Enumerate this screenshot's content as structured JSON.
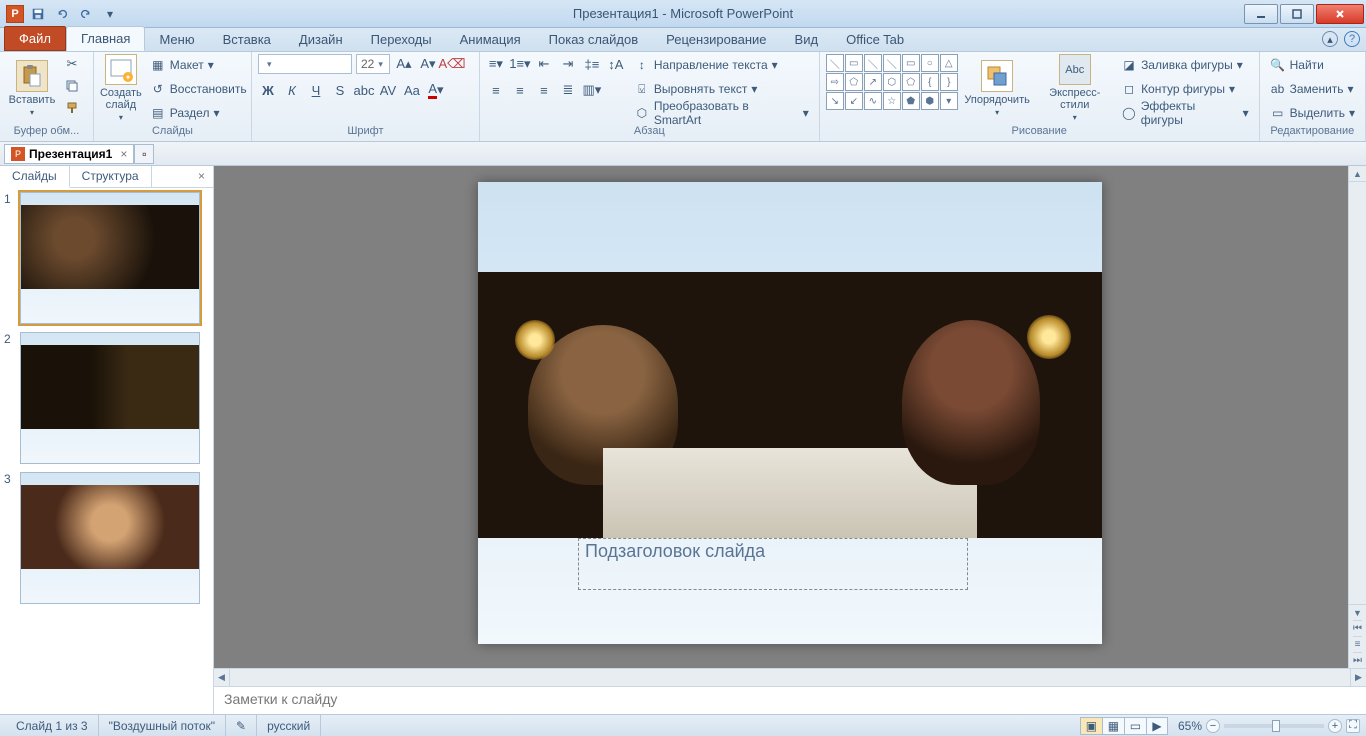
{
  "window": {
    "title": "Презентация1 - Microsoft PowerPoint"
  },
  "tabs": {
    "file": "Файл",
    "items": [
      "Главная",
      "Меню",
      "Вставка",
      "Дизайн",
      "Переходы",
      "Анимация",
      "Показ слайдов",
      "Рецензирование",
      "Вид",
      "Office Tab"
    ],
    "active": "Главная"
  },
  "ribbon": {
    "clipboard": {
      "label": "Буфер обм...",
      "paste": "Вставить"
    },
    "slides": {
      "label": "Слайды",
      "new_slide": "Создать\nслайд",
      "layout": "Макет",
      "reset": "Восстановить",
      "section": "Раздел"
    },
    "font": {
      "label": "Шрифт",
      "size": "22"
    },
    "paragraph": {
      "label": "Абзац",
      "text_direction": "Направление текста",
      "align_text": "Выровнять текст",
      "smartart": "Преобразовать в SmartArt"
    },
    "drawing": {
      "label": "Рисование",
      "arrange": "Упорядочить",
      "quick_styles": "Экспресс-стили",
      "shape_fill": "Заливка фигуры",
      "shape_outline": "Контур фигуры",
      "shape_effects": "Эффекты фигуры"
    },
    "editing": {
      "label": "Редактирование",
      "find": "Найти",
      "replace": "Заменить",
      "select": "Выделить"
    }
  },
  "doctabs": {
    "name": "Презентация1"
  },
  "panel": {
    "slides_tab": "Слайды",
    "outline_tab": "Структура",
    "count": 3
  },
  "slide": {
    "subtitle_placeholder": "Подзаголовок слайда"
  },
  "notes": {
    "placeholder": "Заметки к слайду"
  },
  "status": {
    "slide_info": "Слайд 1 из 3",
    "theme": "\"Воздушный поток\"",
    "language": "русский",
    "zoom": "65%"
  }
}
